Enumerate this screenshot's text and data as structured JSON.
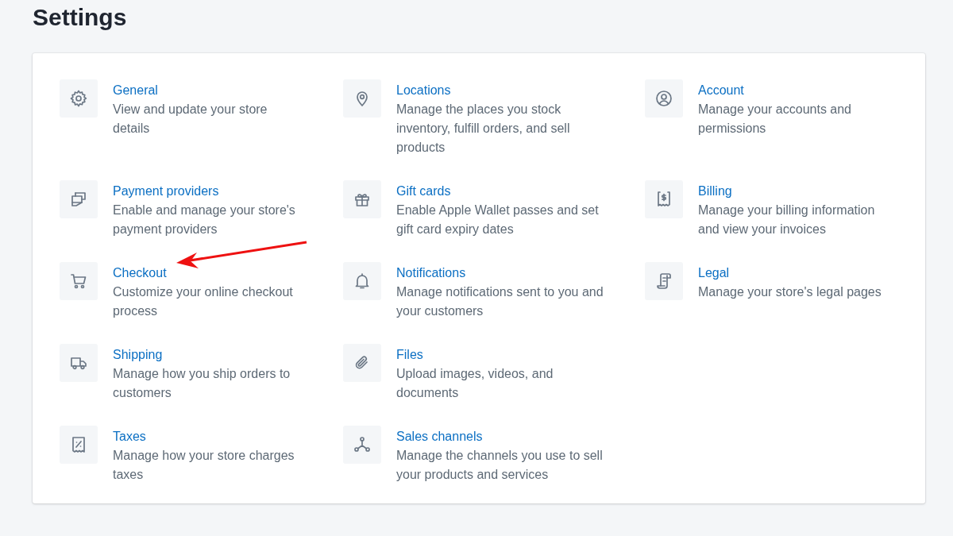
{
  "page_title": "Settings",
  "rows": [
    [
      {
        "kind": "gear",
        "title": "General",
        "description": "View and update your store details"
      },
      {
        "kind": "pin",
        "title": "Locations",
        "description": "Manage the places you stock inventory, fulfill orders, and sell products"
      },
      {
        "kind": "person",
        "title": "Account",
        "description": "Manage your accounts and permissions"
      }
    ],
    [
      {
        "kind": "cards",
        "title": "Payment providers",
        "description": "Enable and manage your store's payment providers"
      },
      {
        "kind": "gift",
        "title": "Gift cards",
        "description": "Enable Apple Wallet passes and set gift card expiry dates"
      },
      {
        "kind": "bill",
        "title": "Billing",
        "description": "Manage your billing information and view your invoices"
      }
    ],
    [
      {
        "kind": "cart",
        "title": "Checkout",
        "description": "Customize your online checkout process"
      },
      {
        "kind": "bell",
        "title": "Notifications",
        "description": "Manage notifications sent to you and your customers"
      },
      {
        "kind": "scroll",
        "title": "Legal",
        "description": "Manage your store's legal pages"
      }
    ],
    [
      {
        "kind": "truck",
        "title": "Shipping",
        "description": "Manage how you ship orders to customers"
      },
      {
        "kind": "clip",
        "title": "Files",
        "description": "Upload images, videos, and documents"
      }
    ],
    [
      {
        "kind": "tax",
        "title": "Taxes",
        "description": "Manage how your store charges taxes"
      },
      {
        "kind": "nodes",
        "title": "Sales channels",
        "description": "Manage the channels you use to sell your products and services"
      }
    ]
  ]
}
